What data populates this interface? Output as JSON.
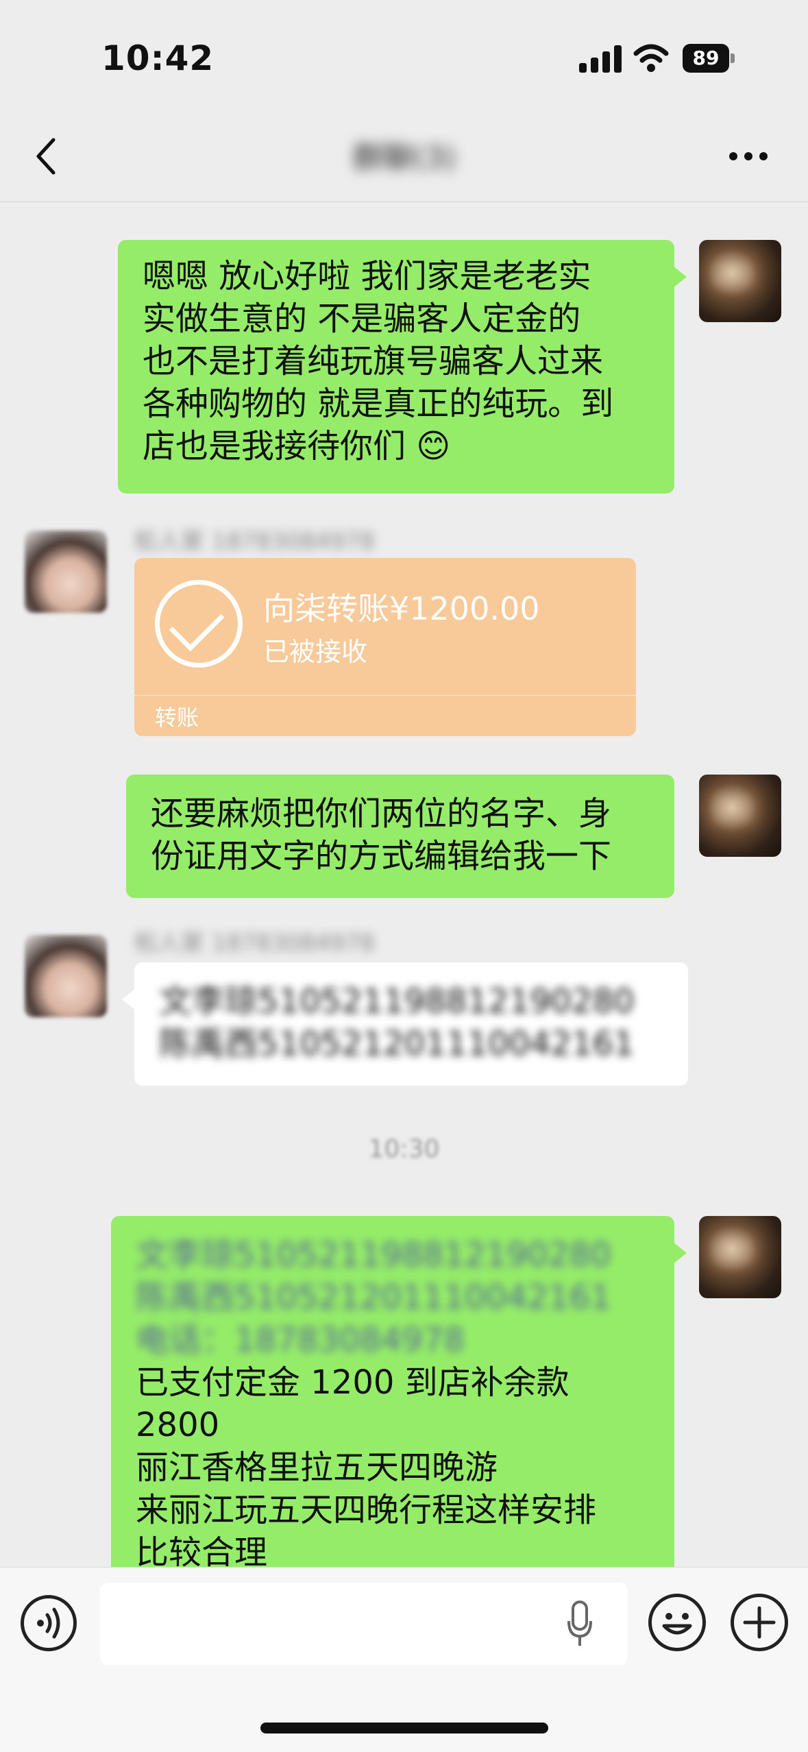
{
  "status_bar": {
    "time": "10:42",
    "battery": "89"
  },
  "nav": {
    "title": "群聊(3)"
  },
  "messages": {
    "m1": {
      "lines": [
        "嗯嗯 放心好啦 我们家是老老实",
        "实做生意的 不是骗客人定金的",
        "也不是打着纯玩旗号骗客人过来",
        "各种购物的 就是真正的纯玩。到",
        "店也是我接待你们 😊"
      ]
    },
    "m2": {
      "sender": "松人家 18783084978",
      "transfer_title": "向柒转账¥1200.00",
      "transfer_status": "已被接收",
      "transfer_label": "转账"
    },
    "m3": {
      "lines": [
        "还要麻烦把你们两位的名字、身",
        "份证用文字的方式编辑给我一下"
      ]
    },
    "m4": {
      "sender": "松人家 18783084978",
      "lines": [
        "文李琼510521198812190280",
        "陈禹西510521201110042161"
      ]
    },
    "timestamp": "10:30",
    "m5": {
      "lines": [
        "文李琼510521198812190280",
        "陈禹西510521201110042161",
        "电话：18783084978",
        "已支付定金 1200 到店补余款",
        "2800",
        "丽江香格里拉五天四晚游",
        "来丽江玩五天四晚行程这样安排",
        "比较合理"
      ]
    }
  },
  "input": {
    "placeholder": ""
  },
  "colors": {
    "green_bubble": "#95ec69",
    "transfer_orange": "#f8ca9a",
    "background": "#ededed"
  },
  "icons": [
    "back-icon",
    "more-icon",
    "voice-icon",
    "mic-icon",
    "emoji-icon",
    "plus-icon",
    "check-icon"
  ]
}
